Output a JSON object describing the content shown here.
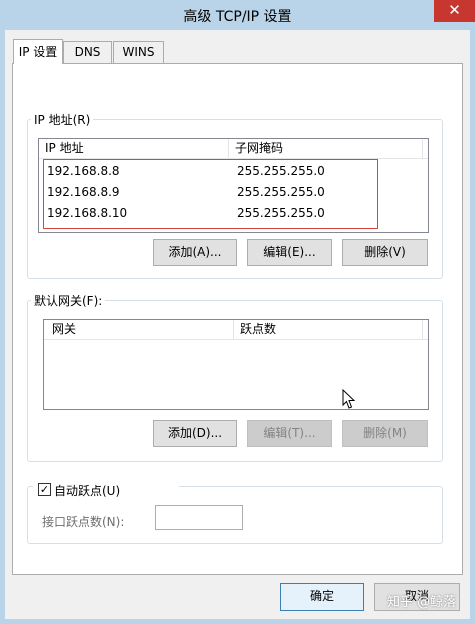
{
  "window": {
    "title": "高级 TCP/IP 设置",
    "close_glyph": "✕"
  },
  "tabs": [
    {
      "label": "IP 设置",
      "active": true
    },
    {
      "label": "DNS",
      "active": false
    },
    {
      "label": "WINS",
      "active": false
    }
  ],
  "ip_group": {
    "label": "IP 地址(R)",
    "columns": [
      "IP 地址",
      "子网掩码"
    ],
    "rows": [
      {
        "ip": "192.168.8.8",
        "mask": "255.255.255.0"
      },
      {
        "ip": "192.168.8.9",
        "mask": "255.255.255.0"
      },
      {
        "ip": "192.168.8.10",
        "mask": "255.255.255.0"
      }
    ],
    "buttons": {
      "add": "添加(A)...",
      "edit": "编辑(E)...",
      "delete": "删除(V)"
    }
  },
  "gateway_group": {
    "label": "默认网关(F):",
    "columns": [
      "网关",
      "跃点数"
    ],
    "buttons": {
      "add": "添加(D)...",
      "edit": "编辑(T)...",
      "delete": "删除(M)"
    }
  },
  "metric_group": {
    "auto_metric_label": "自动跃点(U)",
    "auto_metric_checked": true,
    "interface_metric_label": "接口跃点数(N):",
    "interface_metric_value": ""
  },
  "footer": {
    "ok": "确定",
    "cancel": "取消"
  },
  "watermark": "知乎 @鲸落"
}
